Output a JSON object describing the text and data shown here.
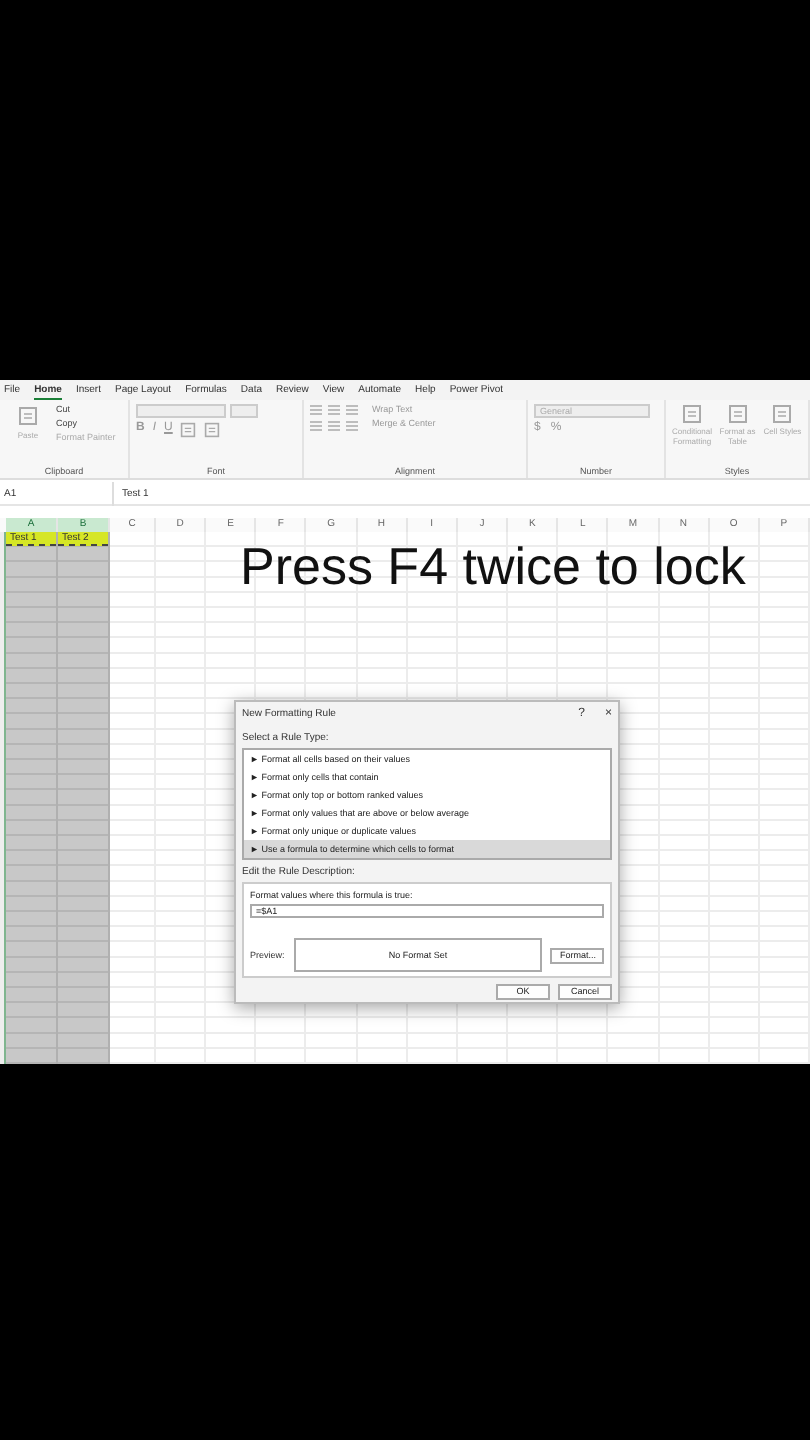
{
  "menu_tabs": [
    {
      "label": "File",
      "selected": false
    },
    {
      "label": "Home",
      "selected": true
    },
    {
      "label": "Insert",
      "selected": false
    },
    {
      "label": "Page Layout",
      "selected": false
    },
    {
      "label": "Formulas",
      "selected": false
    },
    {
      "label": "Data",
      "selected": false
    },
    {
      "label": "Review",
      "selected": false
    },
    {
      "label": "View",
      "selected": false
    },
    {
      "label": "Automate",
      "selected": false
    },
    {
      "label": "Help",
      "selected": false
    },
    {
      "label": "Power Pivot",
      "selected": false
    }
  ],
  "ribbon": {
    "clipboard": {
      "paste": "Paste",
      "items": [
        "Cut",
        "Copy",
        "Format Painter"
      ],
      "label": "Clipboard"
    },
    "font": {
      "buttons": [
        "B",
        "I",
        "U"
      ],
      "label": "Font"
    },
    "alignment": {
      "items": [
        "Wrap Text",
        "Merge & Center"
      ],
      "label": "Alignment"
    },
    "number": {
      "format": "General",
      "symbols": [
        "$",
        "%"
      ],
      "label": "Number"
    },
    "styles": {
      "items": [
        "Conditional Formatting",
        "Format as Table",
        "Cell Styles"
      ],
      "label": "Styles"
    }
  },
  "formula_bar": {
    "name_box": "A1",
    "formula": "Test 1"
  },
  "sheet": {
    "columns": [
      {
        "label": "A",
        "selected": true
      },
      {
        "label": "B",
        "selected": true
      },
      {
        "label": "C",
        "selected": false
      },
      {
        "label": "D",
        "selected": false
      },
      {
        "label": "E",
        "selected": false
      },
      {
        "label": "F",
        "selected": false
      },
      {
        "label": "G",
        "selected": false
      },
      {
        "label": "H",
        "selected": false
      },
      {
        "label": "I",
        "selected": false
      },
      {
        "label": "J",
        "selected": false
      },
      {
        "label": "K",
        "selected": false
      },
      {
        "label": "L",
        "selected": false
      },
      {
        "label": "M",
        "selected": false
      },
      {
        "label": "N",
        "selected": false
      },
      {
        "label": "O",
        "selected": false
      },
      {
        "label": "P",
        "selected": false
      }
    ],
    "cells": [
      {
        "text": "Test 1"
      },
      {
        "text": "Test 2"
      }
    ]
  },
  "caption": "Press F4 twice to lock",
  "dialog": {
    "title": "New Formatting Rule",
    "help": "?",
    "close": "×",
    "rule_type_label": "Select a Rule Type:",
    "rule_types": [
      {
        "label": "► Format all cells based on their values",
        "selected": false
      },
      {
        "label": "► Format only cells that contain",
        "selected": false
      },
      {
        "label": "► Format only top or bottom ranked values",
        "selected": false
      },
      {
        "label": "► Format only values that are above or below average",
        "selected": false
      },
      {
        "label": "► Format only unique or duplicate values",
        "selected": false
      },
      {
        "label": "► Use a formula to determine which cells to format",
        "selected": true
      }
    ],
    "description_label": "Edit the Rule Description:",
    "formula_label": "Format values where this formula is true:",
    "formula": "=$A1",
    "preview_label": "Preview:",
    "preview": "No Format Set",
    "format_button": "Format...",
    "buttons": [
      "OK",
      "Cancel"
    ]
  }
}
